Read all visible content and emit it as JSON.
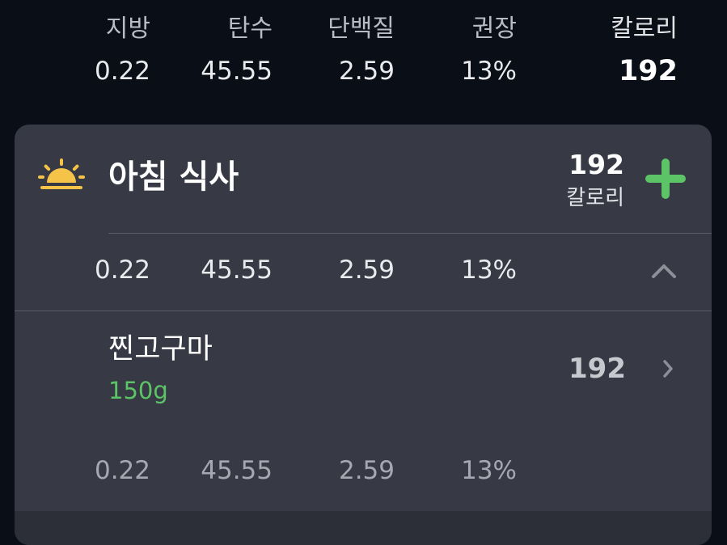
{
  "summary": {
    "labels": {
      "fat": "지방",
      "carbs": "탄수",
      "protein": "단백질",
      "recommended": "권장",
      "calories": "칼로리"
    },
    "values": {
      "fat": "0.22",
      "carbs": "45.55",
      "protein": "2.59",
      "recommended": "13%",
      "calories": "192"
    }
  },
  "meal": {
    "title": "아침 식사",
    "icon": "sunrise-icon",
    "calories": "192",
    "calories_label": "칼로리",
    "add_icon": "plus-icon",
    "macros": {
      "fat": "0.22",
      "carbs": "45.55",
      "protein": "2.59",
      "recommended": "13%"
    },
    "items": [
      {
        "name": "찐고구마",
        "amount": "150g",
        "calories": "192",
        "macros": {
          "fat": "0.22",
          "carbs": "45.55",
          "protein": "2.59",
          "recommended": "13%"
        }
      }
    ]
  },
  "colors": {
    "background": "#0a0e17",
    "card": "#373a45",
    "accent_green": "#5cc466",
    "sun_yellow": "#f5c347"
  }
}
